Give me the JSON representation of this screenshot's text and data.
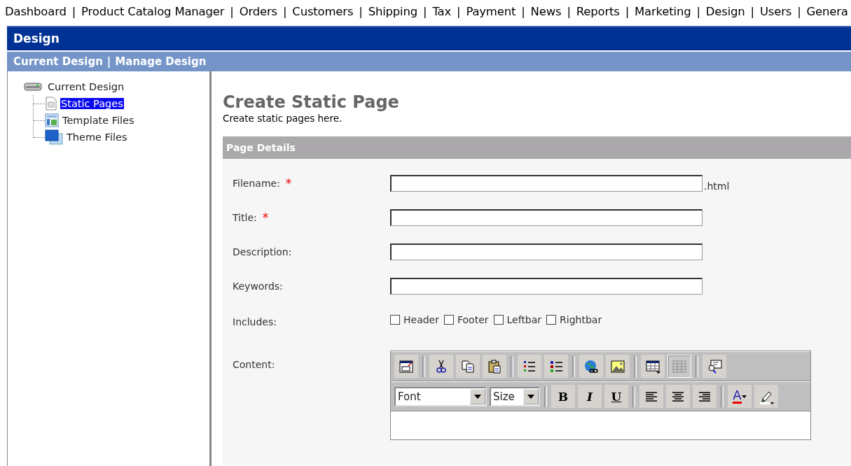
{
  "top_nav": {
    "items": [
      {
        "label": "Dashboard"
      },
      {
        "label": "Product Catalog Manager"
      },
      {
        "label": "Orders"
      },
      {
        "label": "Customers"
      },
      {
        "label": "Shipping"
      },
      {
        "label": "Tax"
      },
      {
        "label": "Payment"
      },
      {
        "label": "News"
      },
      {
        "label": "Reports"
      },
      {
        "label": "Marketing"
      },
      {
        "label": "Design"
      },
      {
        "label": "Users"
      },
      {
        "label": "Genera"
      }
    ],
    "separator": "|"
  },
  "section_title": "Design",
  "sub_nav": {
    "items": [
      {
        "label": "Current Design"
      },
      {
        "label": "Manage Design"
      }
    ],
    "separator": "|"
  },
  "tree": {
    "label": "Current Design",
    "kind": "drive",
    "children": [
      {
        "label": "Static Pages",
        "kind": "page",
        "selected": true
      },
      {
        "label": "Template Files",
        "kind": "template",
        "selected": false
      },
      {
        "label": "Theme Files",
        "kind": "theme",
        "selected": false
      }
    ]
  },
  "page": {
    "title": "Create Static Page",
    "subtitle": "Create static pages here.",
    "panel_title": "Page Details",
    "fields": [
      {
        "kind": "text",
        "label": "Filename:",
        "required": true,
        "suffix": ".html"
      },
      {
        "kind": "text",
        "label": "Title:",
        "required": true
      },
      {
        "kind": "text",
        "label": "Description:",
        "required": false
      },
      {
        "kind": "text",
        "label": "Keywords:",
        "required": false
      },
      {
        "kind": "checkboxes",
        "label": "Includes:",
        "required": false,
        "options": [
          {
            "label": "Header",
            "checked": false
          },
          {
            "label": "Footer",
            "checked": false
          },
          {
            "label": "Leftbar",
            "checked": false
          },
          {
            "label": "Rightbar",
            "checked": false
          }
        ]
      },
      {
        "kind": "editor",
        "label": "Content:",
        "required": false
      }
    ],
    "required_mark": "*",
    "editor": {
      "toolbar_1": [
        [
          {
            "kind": "window",
            "pressed": false
          }
        ],
        [
          {
            "kind": "cut",
            "pressed": false
          },
          {
            "kind": "copy",
            "pressed": false
          },
          {
            "kind": "paste",
            "pressed": false
          }
        ],
        [
          {
            "kind": "ordered-list",
            "pressed": false
          },
          {
            "kind": "bullet-list",
            "pressed": false
          }
        ],
        [
          {
            "kind": "link",
            "pressed": false
          },
          {
            "kind": "image",
            "pressed": false
          }
        ],
        [
          {
            "kind": "insert-table",
            "pressed": false
          },
          {
            "kind": "table",
            "pressed": true
          }
        ],
        [
          {
            "kind": "preview",
            "pressed": false
          }
        ]
      ],
      "font_select": "Font",
      "size_select": "Size",
      "toolbar_2": [
        [
          {
            "kind": "bold",
            "text": "B"
          },
          {
            "kind": "italic",
            "text": "I"
          },
          {
            "kind": "underline",
            "text": "U"
          }
        ],
        [
          {
            "kind": "align-left"
          },
          {
            "kind": "align-center"
          },
          {
            "kind": "align-right"
          }
        ],
        [
          {
            "kind": "font-color",
            "text": "A"
          },
          {
            "kind": "highlight"
          }
        ]
      ]
    }
  }
}
